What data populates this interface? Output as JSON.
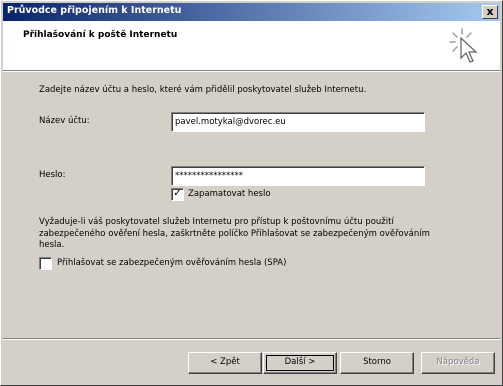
{
  "window": {
    "title": "Průvodce připojením k Internetu",
    "close_glyph": "x"
  },
  "header": {
    "title": "Přihlašování k poště Internetu",
    "icon": "sparkle-cursor-icon"
  },
  "intro_text": "Zadejte název účtu a heslo, které vám přidělil poskytovatel služeb Internetu.",
  "account": {
    "label": "Název účtu:",
    "value": "pavel.motykal@dvorec.eu"
  },
  "password": {
    "label": "Heslo:",
    "value": "****************"
  },
  "remember": {
    "label": "Zapamatovat heslo",
    "checked": true
  },
  "spa_info": "Vyžaduje-li váš poskytovatel služeb Internetu pro přístup k poštovnímu účtu použití zabezpečeného ověření hesla, zaškrtněte políčko Přihlašovat se zabezpečeným ověřováním hesla.",
  "spa": {
    "label": "Přihlašovat se zabezpečeným ověřováním hesla (SPA)",
    "checked": false
  },
  "buttons": {
    "back": "< Zpět",
    "next": "Další >",
    "cancel": "Storno",
    "help": "Nápověda"
  }
}
